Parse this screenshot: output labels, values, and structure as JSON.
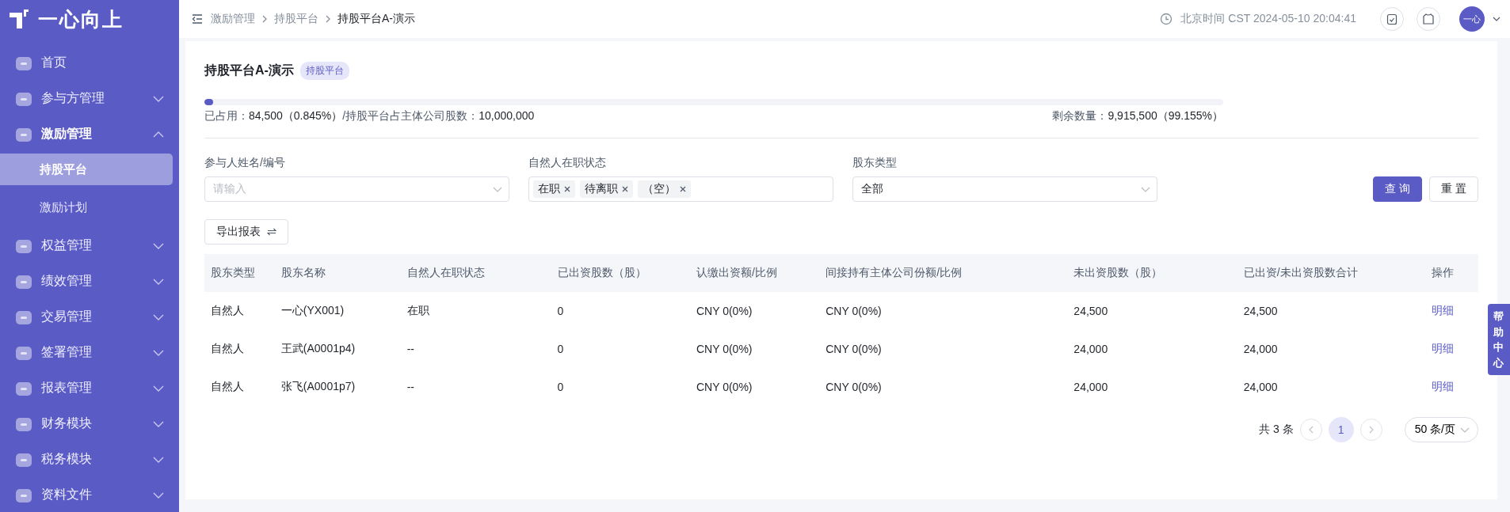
{
  "brand": {
    "name": "一心向上"
  },
  "sidebar": {
    "items": [
      {
        "label": "首页",
        "kind": "link",
        "selected": false
      },
      {
        "label": "参与方管理",
        "kind": "group",
        "expanded": false
      },
      {
        "label": "激励管理",
        "kind": "group",
        "expanded": true,
        "children": [
          {
            "label": "持股平台",
            "selected": true
          },
          {
            "label": "激励计划",
            "selected": false
          }
        ]
      },
      {
        "label": "权益管理",
        "kind": "group",
        "expanded": false
      },
      {
        "label": "绩效管理",
        "kind": "group",
        "expanded": false
      },
      {
        "label": "交易管理",
        "kind": "group",
        "expanded": false
      },
      {
        "label": "签署管理",
        "kind": "group",
        "expanded": false
      },
      {
        "label": "报表管理",
        "kind": "group",
        "expanded": false
      },
      {
        "label": "财务模块",
        "kind": "group",
        "expanded": false
      },
      {
        "label": "税务模块",
        "kind": "group",
        "expanded": false
      },
      {
        "label": "资料文件",
        "kind": "group",
        "expanded": false
      }
    ]
  },
  "header": {
    "breadcrumb": [
      "激励管理",
      "持股平台",
      "持股平台A-演示"
    ],
    "time": "北京时间 CST 2024-05-10 20:04:41",
    "avatar": "一心"
  },
  "page": {
    "title": "持股平台A-演示",
    "tag": "持股平台"
  },
  "usage": {
    "level": 0.00845,
    "used_label": "已占用：",
    "used_value": "84,500（0.845%）",
    "total_label": "/持股平台占主体公司股数：",
    "total_value": "10,000,000",
    "remain_label": "剩余数量：",
    "remain_value": "9,915,500（99.155%）"
  },
  "filters": [
    {
      "label": "参与人姓名/编号",
      "kind": "select",
      "placeholder": "请输入"
    },
    {
      "label": "自然人在职状态",
      "kind": "tags",
      "tags": [
        "在职",
        "待离职",
        "（空）"
      ]
    },
    {
      "label": "股东类型",
      "kind": "select",
      "value": "全部"
    }
  ],
  "buttons": {
    "query": "查 询",
    "reset": "重 置",
    "export": "导出报表"
  },
  "table": {
    "columns": [
      "股东类型",
      "股东名称",
      "自然人在职状态",
      "已出资股数（股）",
      "认缴出资额/比例",
      "间接持有主体公司份额/比例",
      "未出资股数（股）",
      "已出资/未出资股数合计",
      "操作"
    ],
    "rows": [
      [
        "自然人",
        "一心(YX001)",
        "在职",
        "0",
        "CNY 0(0%)",
        "CNY 0(0%)",
        "24,500",
        "24,500",
        "明细"
      ],
      [
        "自然人",
        "王武(A0001p4)",
        "--",
        "0",
        "CNY 0(0%)",
        "CNY 0(0%)",
        "24,000",
        "24,000",
        "明细"
      ],
      [
        "自然人",
        "张飞(A0001p7)",
        "--",
        "0",
        "CNY 0(0%)",
        "CNY 0(0%)",
        "24,000",
        "24,000",
        "明细"
      ]
    ]
  },
  "pagination": {
    "total": "共 3 条",
    "pages": [
      {
        "label": "1",
        "selected": true
      }
    ],
    "page_size": "50 条/页"
  },
  "help": {
    "label": "帮助中心"
  }
}
